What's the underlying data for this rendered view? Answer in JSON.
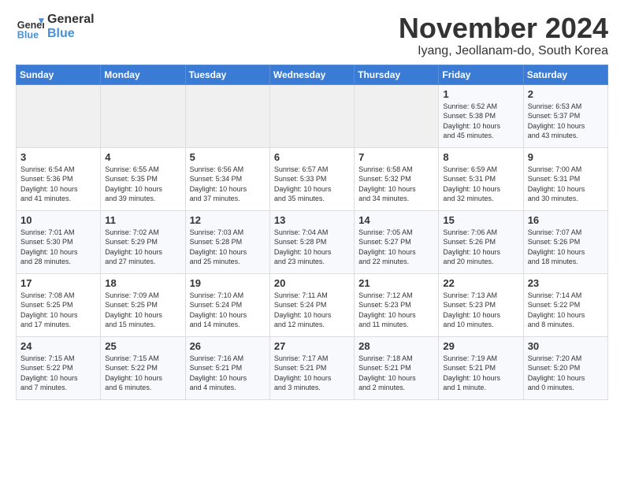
{
  "logo": {
    "text_general": "General",
    "text_blue": "Blue"
  },
  "title": "November 2024",
  "subtitle": "Iyang, Jeollanam-do, South Korea",
  "days_of_week": [
    "Sunday",
    "Monday",
    "Tuesday",
    "Wednesday",
    "Thursday",
    "Friday",
    "Saturday"
  ],
  "weeks": [
    [
      {
        "day": "",
        "info": ""
      },
      {
        "day": "",
        "info": ""
      },
      {
        "day": "",
        "info": ""
      },
      {
        "day": "",
        "info": ""
      },
      {
        "day": "",
        "info": ""
      },
      {
        "day": "1",
        "info": "Sunrise: 6:52 AM\nSunset: 5:38 PM\nDaylight: 10 hours\nand 45 minutes."
      },
      {
        "day": "2",
        "info": "Sunrise: 6:53 AM\nSunset: 5:37 PM\nDaylight: 10 hours\nand 43 minutes."
      }
    ],
    [
      {
        "day": "3",
        "info": "Sunrise: 6:54 AM\nSunset: 5:36 PM\nDaylight: 10 hours\nand 41 minutes."
      },
      {
        "day": "4",
        "info": "Sunrise: 6:55 AM\nSunset: 5:35 PM\nDaylight: 10 hours\nand 39 minutes."
      },
      {
        "day": "5",
        "info": "Sunrise: 6:56 AM\nSunset: 5:34 PM\nDaylight: 10 hours\nand 37 minutes."
      },
      {
        "day": "6",
        "info": "Sunrise: 6:57 AM\nSunset: 5:33 PM\nDaylight: 10 hours\nand 35 minutes."
      },
      {
        "day": "7",
        "info": "Sunrise: 6:58 AM\nSunset: 5:32 PM\nDaylight: 10 hours\nand 34 minutes."
      },
      {
        "day": "8",
        "info": "Sunrise: 6:59 AM\nSunset: 5:31 PM\nDaylight: 10 hours\nand 32 minutes."
      },
      {
        "day": "9",
        "info": "Sunrise: 7:00 AM\nSunset: 5:31 PM\nDaylight: 10 hours\nand 30 minutes."
      }
    ],
    [
      {
        "day": "10",
        "info": "Sunrise: 7:01 AM\nSunset: 5:30 PM\nDaylight: 10 hours\nand 28 minutes."
      },
      {
        "day": "11",
        "info": "Sunrise: 7:02 AM\nSunset: 5:29 PM\nDaylight: 10 hours\nand 27 minutes."
      },
      {
        "day": "12",
        "info": "Sunrise: 7:03 AM\nSunset: 5:28 PM\nDaylight: 10 hours\nand 25 minutes."
      },
      {
        "day": "13",
        "info": "Sunrise: 7:04 AM\nSunset: 5:28 PM\nDaylight: 10 hours\nand 23 minutes."
      },
      {
        "day": "14",
        "info": "Sunrise: 7:05 AM\nSunset: 5:27 PM\nDaylight: 10 hours\nand 22 minutes."
      },
      {
        "day": "15",
        "info": "Sunrise: 7:06 AM\nSunset: 5:26 PM\nDaylight: 10 hours\nand 20 minutes."
      },
      {
        "day": "16",
        "info": "Sunrise: 7:07 AM\nSunset: 5:26 PM\nDaylight: 10 hours\nand 18 minutes."
      }
    ],
    [
      {
        "day": "17",
        "info": "Sunrise: 7:08 AM\nSunset: 5:25 PM\nDaylight: 10 hours\nand 17 minutes."
      },
      {
        "day": "18",
        "info": "Sunrise: 7:09 AM\nSunset: 5:25 PM\nDaylight: 10 hours\nand 15 minutes."
      },
      {
        "day": "19",
        "info": "Sunrise: 7:10 AM\nSunset: 5:24 PM\nDaylight: 10 hours\nand 14 minutes."
      },
      {
        "day": "20",
        "info": "Sunrise: 7:11 AM\nSunset: 5:24 PM\nDaylight: 10 hours\nand 12 minutes."
      },
      {
        "day": "21",
        "info": "Sunrise: 7:12 AM\nSunset: 5:23 PM\nDaylight: 10 hours\nand 11 minutes."
      },
      {
        "day": "22",
        "info": "Sunrise: 7:13 AM\nSunset: 5:23 PM\nDaylight: 10 hours\nand 10 minutes."
      },
      {
        "day": "23",
        "info": "Sunrise: 7:14 AM\nSunset: 5:22 PM\nDaylight: 10 hours\nand 8 minutes."
      }
    ],
    [
      {
        "day": "24",
        "info": "Sunrise: 7:15 AM\nSunset: 5:22 PM\nDaylight: 10 hours\nand 7 minutes."
      },
      {
        "day": "25",
        "info": "Sunrise: 7:15 AM\nSunset: 5:22 PM\nDaylight: 10 hours\nand 6 minutes."
      },
      {
        "day": "26",
        "info": "Sunrise: 7:16 AM\nSunset: 5:21 PM\nDaylight: 10 hours\nand 4 minutes."
      },
      {
        "day": "27",
        "info": "Sunrise: 7:17 AM\nSunset: 5:21 PM\nDaylight: 10 hours\nand 3 minutes."
      },
      {
        "day": "28",
        "info": "Sunrise: 7:18 AM\nSunset: 5:21 PM\nDaylight: 10 hours\nand 2 minutes."
      },
      {
        "day": "29",
        "info": "Sunrise: 7:19 AM\nSunset: 5:21 PM\nDaylight: 10 hours\nand 1 minute."
      },
      {
        "day": "30",
        "info": "Sunrise: 7:20 AM\nSunset: 5:20 PM\nDaylight: 10 hours\nand 0 minutes."
      }
    ]
  ]
}
